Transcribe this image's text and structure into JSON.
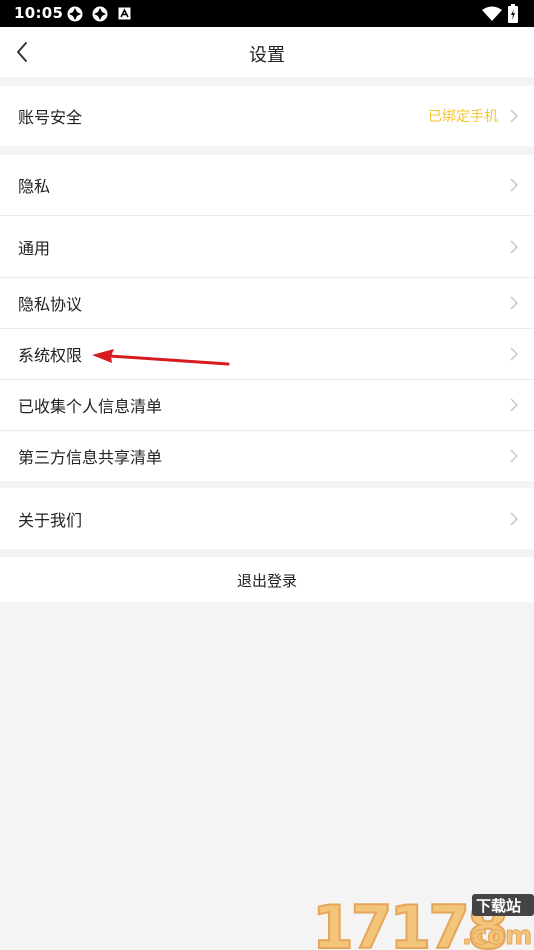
{
  "status_bar": {
    "time": "10:05"
  },
  "header": {
    "title": "设置"
  },
  "account": {
    "label": "账号安全",
    "value": "已绑定手机"
  },
  "settings_items": [
    {
      "label": "隐私"
    },
    {
      "label": "通用"
    },
    {
      "label": "隐私协议"
    },
    {
      "label": "系统权限"
    },
    {
      "label": "已收集个人信息清单"
    },
    {
      "label": "第三方信息共享清单"
    }
  ],
  "about": {
    "label": "关于我们"
  },
  "logout": {
    "label": "退出登录"
  },
  "watermark": {
    "number": "17178",
    "site": "下载站",
    "tld": ".com"
  },
  "colors": {
    "accent": "#f6c331",
    "arrow": "#d71920",
    "background": "#f4f4f4"
  }
}
